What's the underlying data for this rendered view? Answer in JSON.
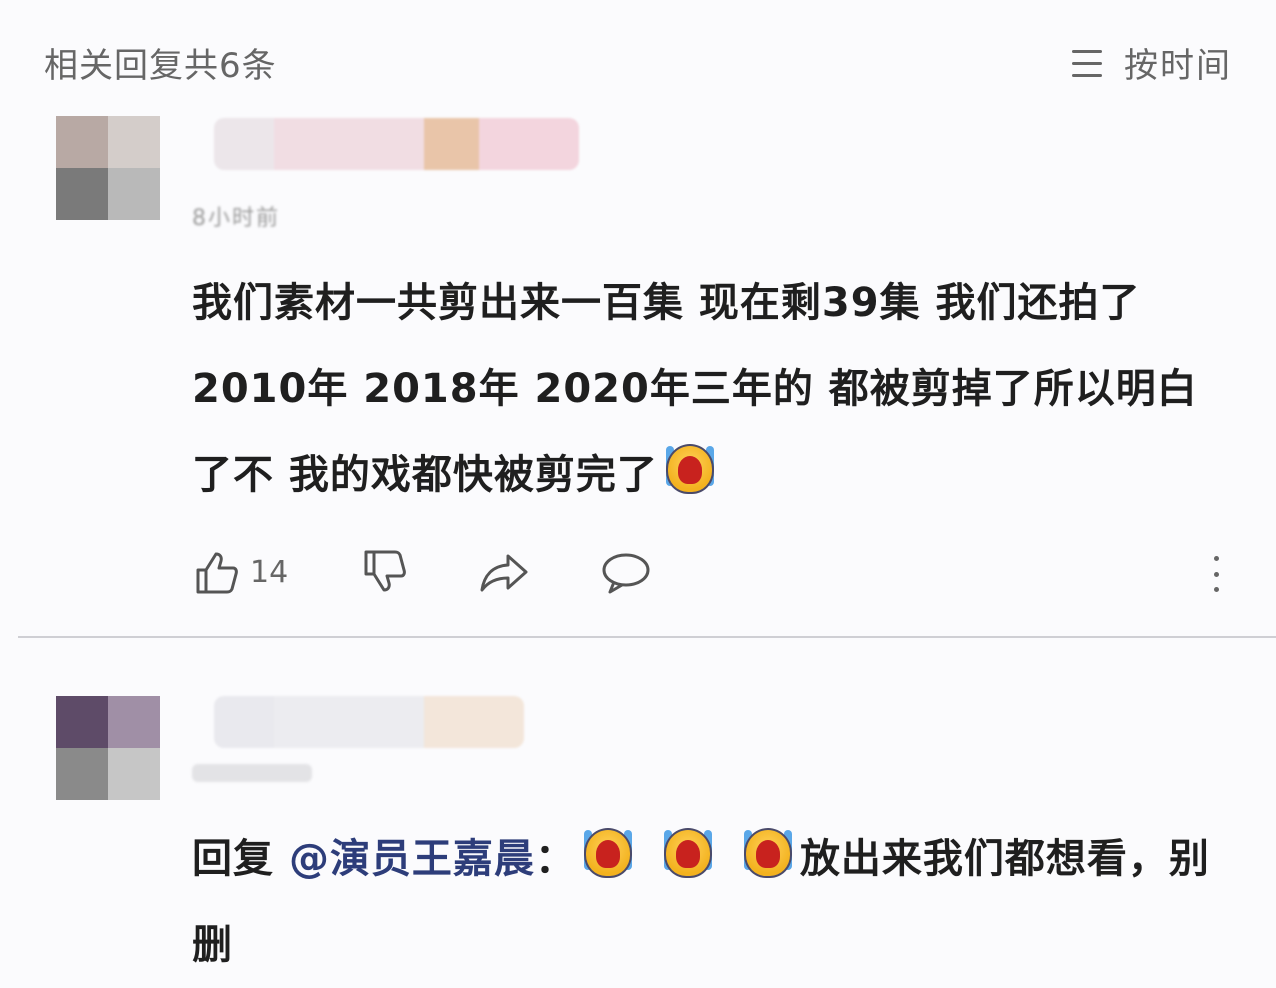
{
  "header": {
    "title": "相关回复共6条",
    "sort_label": "按时间",
    "sort_icon": "sort-lines-icon"
  },
  "comment1": {
    "time": "8小时前",
    "text": "我们素材一共剪出来一百集 现在剩39集 我们还拍了2010年 2018年 2020年三年的 都被剪掉了所以明白了不 我的戏都快被剪完了",
    "emoji": "crying-emoji-icon",
    "likes": "14",
    "actions": [
      "like-icon",
      "dislike-icon",
      "share-icon",
      "reply-icon",
      "more-icon"
    ]
  },
  "comment2": {
    "reply_prefix": "回复",
    "mention": "@演员王嘉晨",
    "colon": "：",
    "emoji_count": 3,
    "text_after": "放出来我们都想看，别删"
  },
  "colors": {
    "background": "#fbfbfd",
    "text": "#1f1f1f",
    "muted": "#666666",
    "mention": "#2d3d7a"
  }
}
